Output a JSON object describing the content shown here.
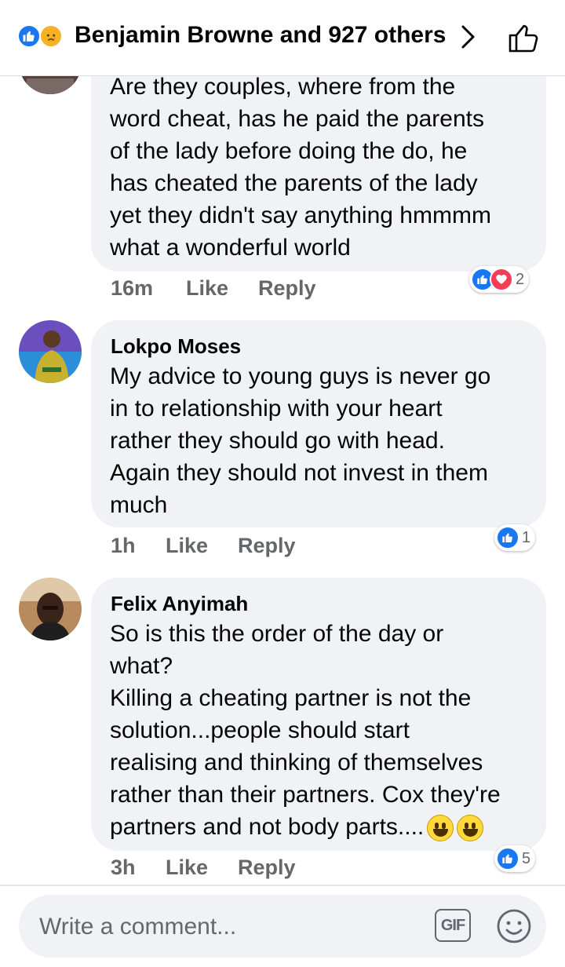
{
  "header": {
    "title": "Benjamin Browne and 927 others"
  },
  "comments": [
    {
      "author": "",
      "lines": [
        "Are they couples, where from the",
        "word cheat, has he paid the parents",
        "of the lady before doing the do, he",
        "has cheated the parents of the lady",
        "yet they didn't say anything hmmmm",
        "what a wonderful world"
      ],
      "time": "16m",
      "like_label": "Like",
      "reply_label": "Reply",
      "reaction_count": "2"
    },
    {
      "author": "Lokpo Moses",
      "lines": [
        "My advice to young guys is never go",
        "in to relationship with your heart",
        "rather they should go with head.",
        "Again they should not invest in them",
        "much"
      ],
      "time": "1h",
      "like_label": "Like",
      "reply_label": "Reply",
      "reaction_count": "1"
    },
    {
      "author": "Felix Anyimah",
      "lines": [
        "So is this the order of the day or",
        "what?",
        "Killing a cheating partner is not the",
        "solution...people should start",
        "realising and thinking of themselves",
        "rather than their partners. Cox they're",
        "partners and not body parts...."
      ],
      "time": "3h",
      "like_label": "Like",
      "reply_label": "Reply",
      "reaction_count": "5"
    }
  ],
  "composer": {
    "placeholder": "Write a comment...",
    "gif_label": "GIF"
  },
  "colors": {
    "accent_blue": "#1877f2",
    "love_red": "#f33e58",
    "bubble_bg": "#f0f2f5",
    "meta_gray": "#65676b"
  },
  "icons": [
    "like-reaction-icon",
    "sad-reaction-icon",
    "love-reaction-icon",
    "chevron-right-icon",
    "thumbs-up-icon",
    "smiley-emoji-icon",
    "emoji-picker-icon"
  ]
}
